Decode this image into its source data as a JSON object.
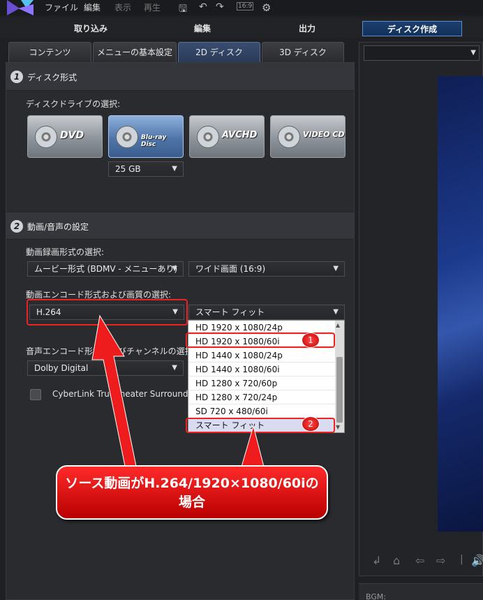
{
  "menu": {
    "file": "ファイル",
    "edit": "編集",
    "view": "表示",
    "play": "再生",
    "aspect": "16:9"
  },
  "main_tabs": [
    "取り込み",
    "編集",
    "出力",
    "ディスク作成"
  ],
  "sub_tabs": [
    "コンテンツ",
    "メニューの基本設定",
    "2D ディスク",
    "3D ディスク"
  ],
  "section1": {
    "number": "1",
    "title": "ディスク形式",
    "drive_label": "ディスクドライブの選択:",
    "discs": [
      "DVD",
      "Blu-ray Disc",
      "AVCHD",
      "VIDEO CD"
    ],
    "capacity": "25 GB"
  },
  "section2": {
    "number": "2",
    "title": "動画/音声の設定",
    "record_format_label": "動画録画形式の選択:",
    "record_format": "ムービー形式 (BDMV - メニューあり)",
    "aspect": "ワイド画面 (16:9)",
    "encode_label": "動画エンコード形式および画質の選択:",
    "encode_format": "H.264",
    "quality": "スマート フィット",
    "audio_label": "音声エンコード形式およびチャンネルの選択:",
    "audio_format": "Dolby Digital",
    "trutheater": "CyberLink TrueTheater Surround"
  },
  "quality_options": [
    "HD 1920 x 1080/24p",
    "HD 1920 x 1080/60i",
    "HD 1440 x 1080/24p",
    "HD 1440 x 1080/60i",
    "HD 1280 x 720/60p",
    "HD 1280 x 720/24p",
    "SD 720 x 480/60i",
    "スマート フィット"
  ],
  "annotations": {
    "badge1": "1",
    "badge2": "2",
    "callout_line1": "ソース動画がH.264/1920×1080/60iの",
    "callout_line2": "場合"
  },
  "preview": {
    "bgm_label": "BGM:"
  },
  "colors": {
    "accent": "#1d3f6e",
    "annotation_red": "#ee2222"
  }
}
